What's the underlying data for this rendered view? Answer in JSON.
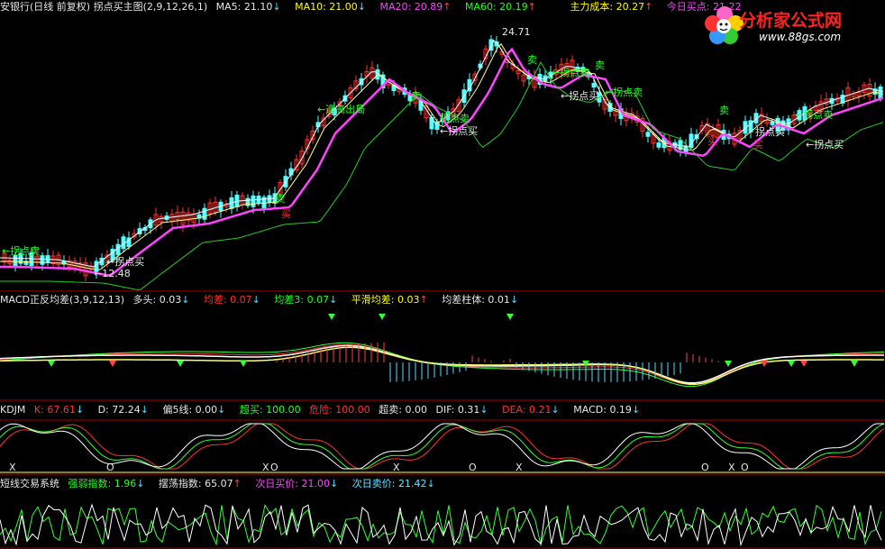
{
  "main_header": {
    "title": "安银行(日线 前复权) 拐点买主图(2,9,12,26,1)",
    "ma5": "MA5: 21.10",
    "ma10": "MA10: 21.00",
    "ma20": "MA20: 20.89",
    "ma60": "MA60: 20.19",
    "cost": "主力成本: 20.27",
    "next_buy": "今日买点: 21.22"
  },
  "logo": {
    "text": "分析家公式网",
    "url": "www.88gs.com"
  },
  "price_labels": {
    "high": "24.71",
    "low": "12.48",
    "sell1": "拐点卖",
    "buy1": "拐点买",
    "break": "逢高出局",
    "buy2": "拐点买",
    "sell2": "拐点卖",
    "sell3": "拐点卖",
    "buy3": "拐点买",
    "sell4": "拐点卖",
    "sell5": "拐点卖",
    "buy4": "拐点买",
    "buy5": "拐点买",
    "tag_sell": "卖",
    "tag_buy": "买",
    "tag_sell_small": "卖"
  },
  "macd_header": {
    "title": "MACD正反均差(3,9,12,13)",
    "multi": "多头: 0.03",
    "avg": "均差: 0.07",
    "avg3": "均差3: 0.07",
    "smooth": "平滑均差: 0.03",
    "col": "均差柱体: 0.01"
  },
  "kdj_header": {
    "title": "KDJM",
    "k": "K: 67.61",
    "d": "D: 72.24",
    "p5": "偏5线: 0.00",
    "over_buy": "超买: 100.00",
    "danger": "危险: 100.00",
    "over_sell": "超卖: 0.00",
    "dif": "DIF: 0.31",
    "dea": "DEA: 0.21",
    "macd": "MACD: 0.19",
    "markers": [
      "X",
      "O",
      "X",
      "O",
      "X",
      "O",
      "X",
      "O",
      "O",
      "X",
      "O"
    ]
  },
  "trade_header": {
    "title": "短线交易系统",
    "strength": "强弱指数: 1.96",
    "swing": "摆荡指数: 65.07",
    "buy_price": "次日买价: 21.00",
    "sell_price": "次日卖价: 21.42"
  },
  "colors": {
    "up": "#ff3030",
    "down": "#55ffff",
    "ma5": "#ffffff",
    "ma10": "#ffff88",
    "ma20": "#ff44ff",
    "ma60": "#22cc22",
    "border": "#aa0000"
  }
}
